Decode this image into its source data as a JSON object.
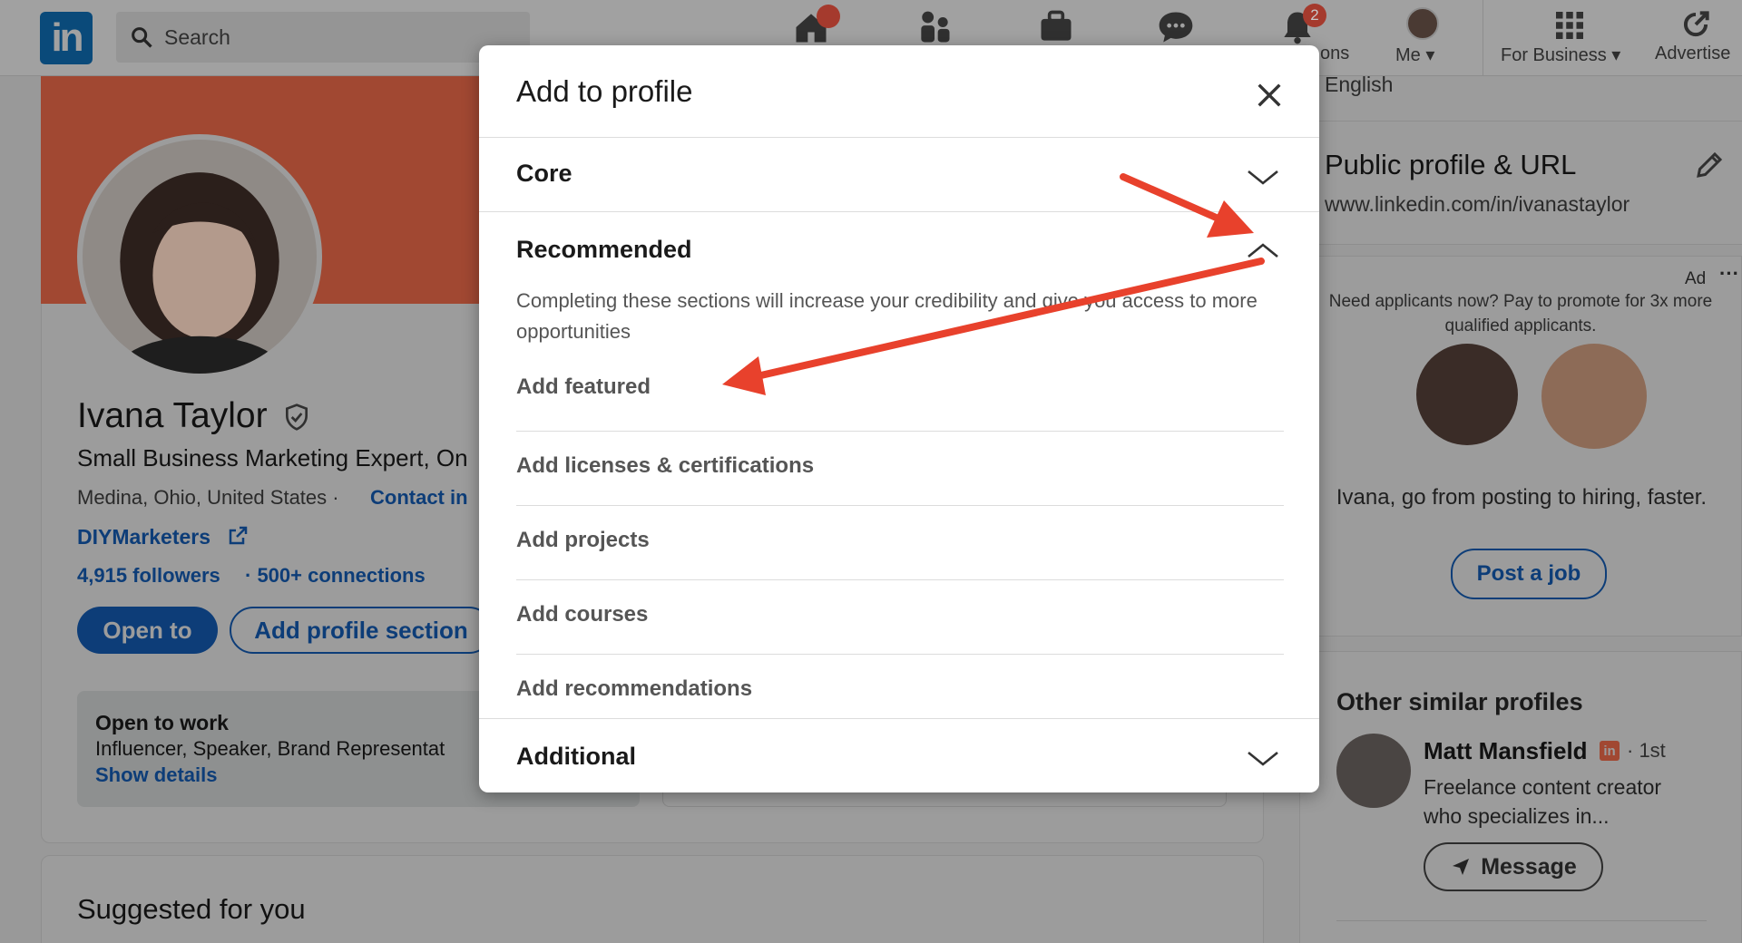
{
  "nav": {
    "search_placeholder": "Search",
    "notifications_badge": "2",
    "home_badge": "",
    "notifications_partial_label": "ons",
    "me_label": "Me",
    "business_label": "For Business",
    "advertise_label": "Advertise"
  },
  "profile": {
    "name": "Ivana Taylor",
    "headline": "Small Business Marketing Expert, On",
    "location": "Medina, Ohio, United States ·",
    "contact_link": "Contact in",
    "website": "DIYMarketers",
    "followers": "4,915 followers",
    "connections": "· 500+ connections",
    "open_to_button": "Open to",
    "add_section_button": "Add profile section",
    "open_to_work_title": "Open to work",
    "open_to_work_roles": "Influencer, Speaker, Brand Representat",
    "show_details": "Show details",
    "suggested_title": "Suggested for you"
  },
  "sidebar": {
    "language_partial": "English",
    "public_profile_title": "Public profile & URL",
    "public_profile_url": "www.linkedin.com/in/ivanastaylor",
    "ad_label": "Ad",
    "ad_more": "···",
    "ad_text": "Need applicants now? Pay to promote for 3x more qualified applicants.",
    "ad_tagline": "Ivana, go from posting to hiring, faster.",
    "post_job_button": "Post a job",
    "similar_title": "Other similar profiles",
    "similar_name": "Matt Mansfield",
    "similar_degree": "· 1st",
    "similar_headline_1": "Freelance content creator",
    "similar_headline_2": "who specializes in...",
    "message_button": "Message"
  },
  "modal": {
    "title": "Add to profile",
    "core_label": "Core",
    "recommended_label": "Recommended",
    "recommended_desc": "Completing these sections will increase your credibility and give you access to more opportunities",
    "items": [
      {
        "label": "Add featured"
      },
      {
        "label": "Add licenses & certifications"
      },
      {
        "label": "Add projects"
      },
      {
        "label": "Add courses"
      },
      {
        "label": "Add recommendations"
      }
    ],
    "additional_label": "Additional"
  },
  "colors": {
    "arrow": "#e8412c",
    "link_blue": "#0d3d78",
    "modal_bg": "#ffffff"
  }
}
